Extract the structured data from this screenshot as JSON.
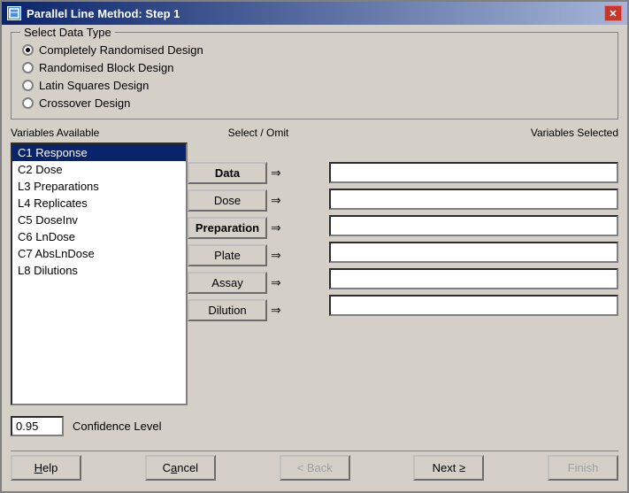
{
  "window": {
    "title": "Parallel Line Method: Step 1",
    "close_label": "✕"
  },
  "data_type_group": {
    "legend": "Select Data Type",
    "options": [
      {
        "label": "Completely Randomised Design",
        "selected": true
      },
      {
        "label": "Randomised Block Design",
        "selected": false
      },
      {
        "label": "Latin Squares Design",
        "selected": false
      },
      {
        "label": "Crossover Design",
        "selected": false
      }
    ]
  },
  "variables_panel": {
    "header": "Variables Available",
    "items": [
      {
        "label": "C1 Response",
        "selected": true
      },
      {
        "label": "C2 Dose",
        "selected": false
      },
      {
        "label": "L3 Preparations",
        "selected": false
      },
      {
        "label": "L4 Replicates",
        "selected": false
      },
      {
        "label": "C5 DoseInv",
        "selected": false
      },
      {
        "label": "C6 LnDose",
        "selected": false
      },
      {
        "label": "C7 AbsLnDose",
        "selected": false
      },
      {
        "label": "L8 Dilutions",
        "selected": false
      }
    ]
  },
  "select_omit": {
    "header": "Select / Omit",
    "buttons": [
      {
        "label": "Data",
        "bold": true
      },
      {
        "label": "Dose",
        "bold": false
      },
      {
        "label": "Preparation",
        "bold": true
      },
      {
        "label": "Plate",
        "bold": false
      },
      {
        "label": "Assay",
        "bold": false
      },
      {
        "label": "Dilution",
        "bold": false
      }
    ]
  },
  "variables_selected": {
    "header": "Variables Selected",
    "fields": [
      "",
      "",
      "",
      "",
      "",
      ""
    ]
  },
  "confidence": {
    "value": "0.95",
    "label": "Confidence Level"
  },
  "bottom_buttons": [
    {
      "label": "Help",
      "underline_index": 0,
      "disabled": false,
      "id": "help"
    },
    {
      "label": "Cancel",
      "underline_index": 1,
      "disabled": false,
      "id": "cancel"
    },
    {
      "label": "< Back",
      "underline_index": null,
      "disabled": true,
      "id": "back"
    },
    {
      "label": "Next ≥",
      "underline_index": null,
      "disabled": false,
      "id": "next"
    },
    {
      "label": "Finish",
      "underline_index": null,
      "disabled": true,
      "id": "finish"
    }
  ]
}
